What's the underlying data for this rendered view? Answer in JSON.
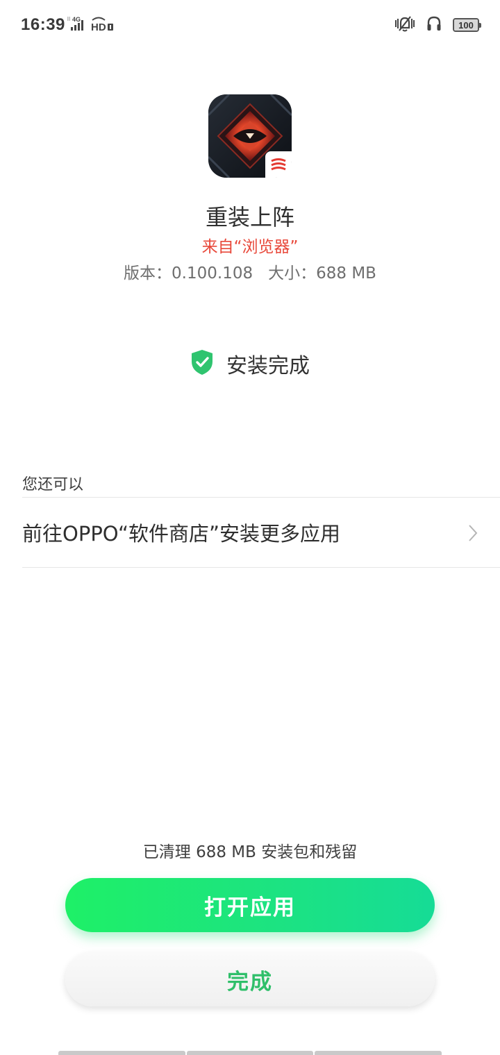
{
  "status_bar": {
    "time": "16:39",
    "network": "4G",
    "hd_label": "HD",
    "battery": "100"
  },
  "app": {
    "name": "重装上阵",
    "source": "来自“浏览器”",
    "version": "版本：0.100.108",
    "size": "大小：688 MB"
  },
  "install": {
    "status": "安装完成"
  },
  "more": {
    "label": "您还可以",
    "store_link": "前往OPPO“软件商店”安装更多应用"
  },
  "footer": {
    "cleanup_note": "已清理 688 MB 安装包和残留",
    "open_button": "打开应用",
    "done_button": "完成"
  },
  "colors": {
    "accent_green": "#1de47e",
    "source_red": "#e8483a",
    "done_text_green": "#2fbf6a"
  }
}
